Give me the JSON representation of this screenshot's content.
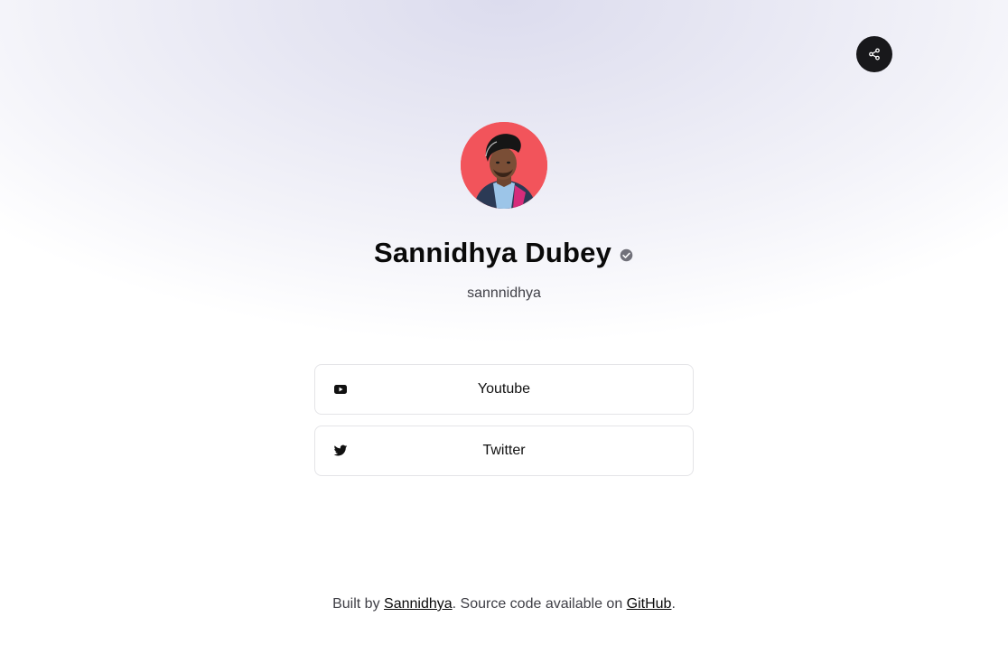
{
  "profile": {
    "name": "Sannidhya Dubey",
    "username": "sannnidhya",
    "avatar_bg": "#f2545b"
  },
  "share": {
    "icon": "share-icon",
    "bg": "#18181b"
  },
  "links": [
    {
      "label": "Youtube",
      "icon": "youtube-icon"
    },
    {
      "label": "Twitter",
      "icon": "twitter-icon"
    }
  ],
  "footer": {
    "prefix": "Built by ",
    "author_link": "Sannidhya",
    "middle": ". Source code available on ",
    "source_link": "GitHub",
    "suffix": "."
  }
}
